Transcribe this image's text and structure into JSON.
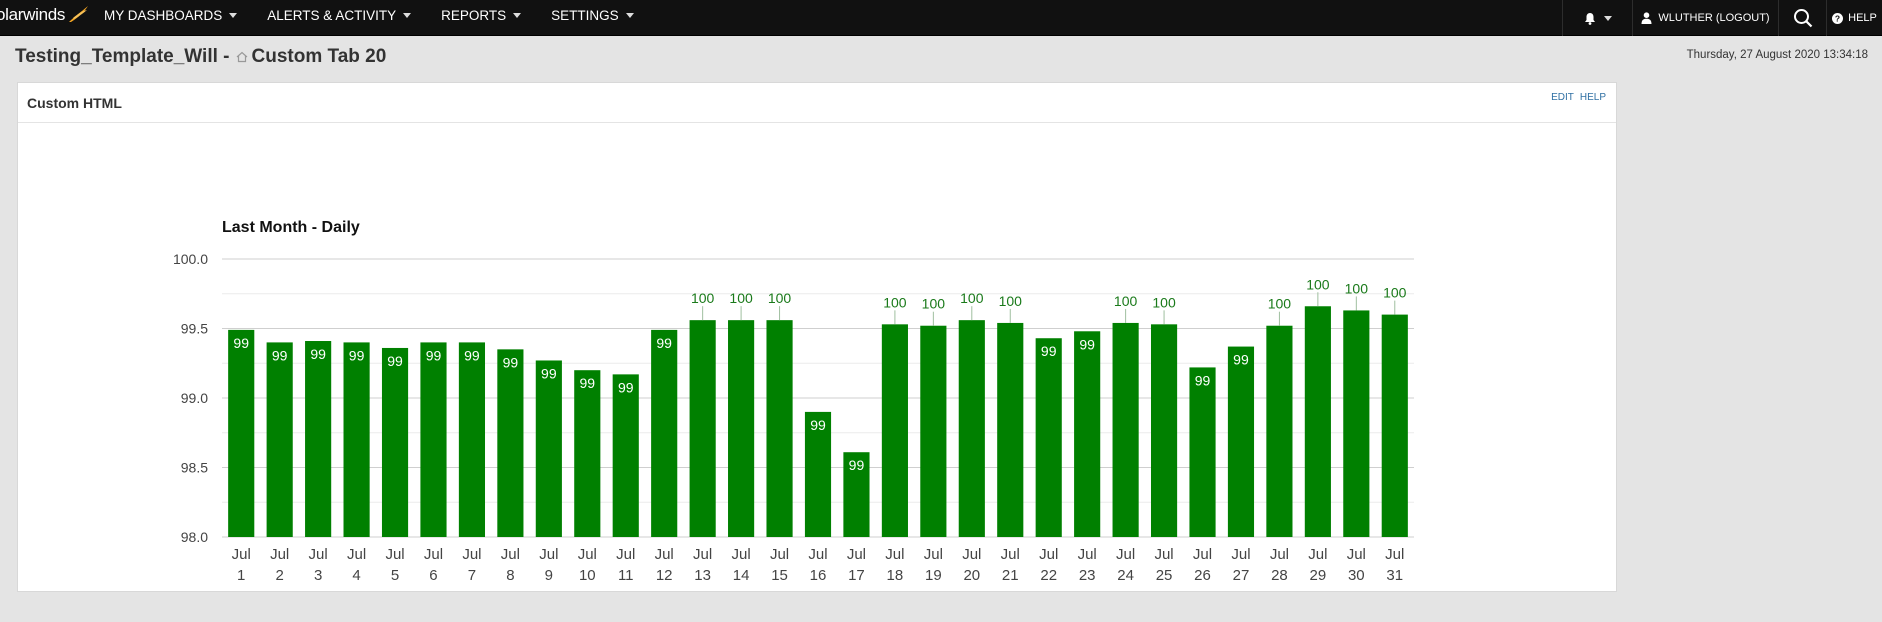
{
  "brand": {
    "name": "olarwinds"
  },
  "nav": {
    "items": [
      {
        "label": "MY DASHBOARDS"
      },
      {
        "label": "ALERTS & ACTIVITY"
      },
      {
        "label": "REPORTS"
      },
      {
        "label": "SETTINGS"
      }
    ],
    "user_label": "WLUTHER (LOGOUT)",
    "help_label": "HELP"
  },
  "page": {
    "title_prefix": "Testing_Template_Will -",
    "title_tab": "Custom Tab 20",
    "datetime": "Thursday, 27 August 2020 13:34:18"
  },
  "panel": {
    "title": "Custom HTML",
    "edit_label": "EDIT",
    "help_label": "HELP"
  },
  "colors": {
    "bar": "#008000",
    "nav_bg": "#111111",
    "brand_accent": "#f5a623"
  },
  "chart_data": {
    "type": "bar",
    "title": "Last Month - Daily",
    "xlabel": "",
    "ylabel": "",
    "ylim": [
      98.0,
      100.0
    ],
    "yticks": [
      "98.0",
      "98.5",
      "99.0",
      "99.5",
      "100.0"
    ],
    "grid": true,
    "categories": [
      "Jul 1",
      "Jul 2",
      "Jul 3",
      "Jul 4",
      "Jul 5",
      "Jul 6",
      "Jul 7",
      "Jul 8",
      "Jul 9",
      "Jul 10",
      "Jul 11",
      "Jul 12",
      "Jul 13",
      "Jul 14",
      "Jul 15",
      "Jul 16",
      "Jul 17",
      "Jul 18",
      "Jul 19",
      "Jul 20",
      "Jul 21",
      "Jul 22",
      "Jul 23",
      "Jul 24",
      "Jul 25",
      "Jul 26",
      "Jul 27",
      "Jul 28",
      "Jul 29",
      "Jul 30",
      "Jul 31"
    ],
    "values": [
      99.49,
      99.4,
      99.41,
      99.4,
      99.36,
      99.4,
      99.4,
      99.35,
      99.27,
      99.2,
      99.17,
      99.49,
      99.56,
      99.56,
      99.56,
      98.9,
      98.61,
      99.53,
      99.52,
      99.56,
      99.54,
      99.43,
      99.48,
      99.54,
      99.53,
      99.22,
      99.37,
      99.52,
      99.66,
      99.63,
      99.6
    ],
    "labels": [
      "99",
      "99",
      "99",
      "99",
      "99",
      "99",
      "99",
      "99",
      "99",
      "99",
      "99",
      "99",
      "100",
      "100",
      "100",
      "99",
      "99",
      "100",
      "100",
      "100",
      "100",
      "99",
      "99",
      "100",
      "100",
      "99",
      "99",
      "100",
      "100",
      "100",
      "100"
    ]
  }
}
